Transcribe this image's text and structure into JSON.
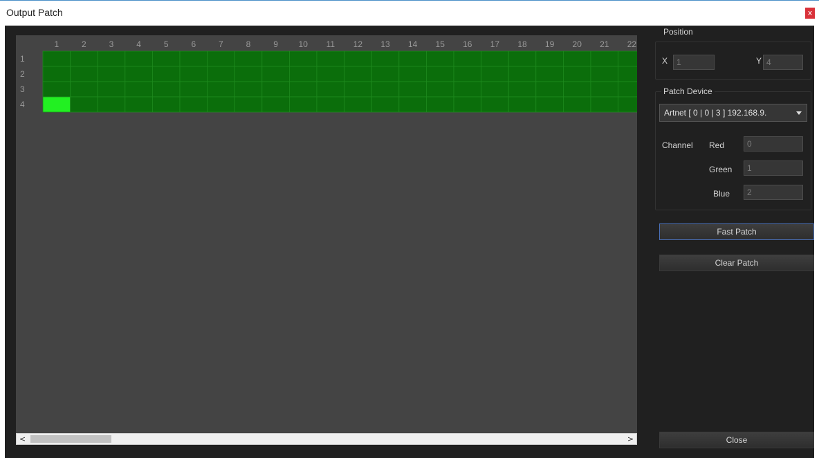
{
  "window": {
    "title": "Output Patch",
    "close_glyph": "x"
  },
  "grid": {
    "column_labels": [
      "1",
      "2",
      "3",
      "4",
      "5",
      "6",
      "7",
      "8",
      "9",
      "10",
      "11",
      "12",
      "13",
      "14",
      "15",
      "16",
      "17",
      "18",
      "19",
      "20",
      "21",
      "22"
    ],
    "row_labels": [
      "1",
      "2",
      "3",
      "4"
    ],
    "selected_cell": {
      "row": 4,
      "col": 1
    },
    "colors": {
      "cell": "#0b6e0b",
      "cell_border": "#1f8a1f",
      "selected": "#22f022",
      "label": "#9a9a9a",
      "background": "#444444"
    }
  },
  "scrollbar": {
    "left_arrow": "<",
    "right_arrow": ">"
  },
  "position": {
    "title": "Position",
    "x_label": "X",
    "x_value": "1",
    "y_label": "Y",
    "y_value": "4"
  },
  "patch_device": {
    "title": "Patch Device",
    "selected": "Artnet [ 0 | 0 | 3 ] 192.168.9.",
    "channel_label": "Channel",
    "red_label": "Red",
    "red_value": "0",
    "green_label": "Green",
    "green_value": "1",
    "blue_label": "Blue",
    "blue_value": "2"
  },
  "buttons": {
    "fast_patch": "Fast Patch",
    "clear_patch": "Clear Patch",
    "close": "Close"
  }
}
